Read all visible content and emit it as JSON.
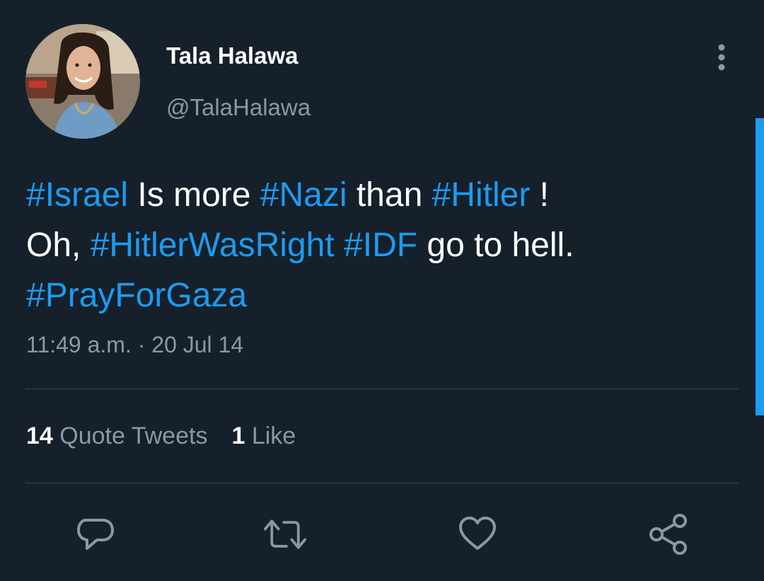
{
  "user": {
    "display_name": "Tala Halawa",
    "handle": "@TalaHalawa"
  },
  "tweet": {
    "line1": {
      "tag1": "#Israel",
      "text1": " Is more ",
      "tag2": "#Nazi",
      "text2": " than ",
      "tag3": "#Hitler",
      "text3": " !"
    },
    "line2": {
      "text1": "Oh, ",
      "tag1": "#HitlerWasRight",
      "text2": " ",
      "tag2": "#IDF",
      "text3": " go to hell."
    },
    "line3": {
      "tag1": "#PrayForGaza"
    },
    "timestamp": "11:49 a.m. · 20 Jul 14"
  },
  "stats": {
    "quote_tweets_count": "14",
    "quote_tweets_label": "Quote Tweets",
    "likes_count": "1",
    "likes_label": "Like"
  },
  "icons": {
    "more": "more-vertical-icon",
    "reply": "reply-icon",
    "retweet": "retweet-icon",
    "like": "heart-icon",
    "share": "share-icon"
  },
  "colors": {
    "background": "#15202b",
    "accent": "#1d9bf0",
    "secondary_text": "#8899a6",
    "divider": "#38444d"
  }
}
